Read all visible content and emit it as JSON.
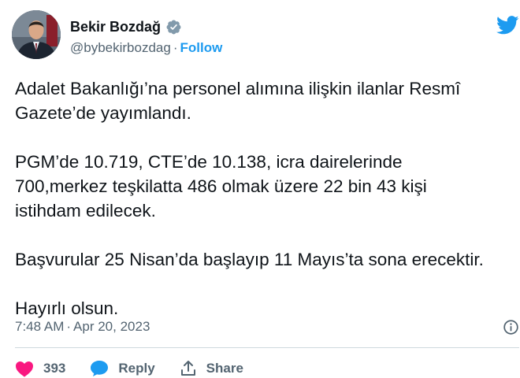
{
  "author": {
    "name": "Bekir Bozdağ",
    "handle": "@bybekirbozdag",
    "separator": "·",
    "follow_label": "Follow"
  },
  "tweet": {
    "paragraphs": [
      [
        "Adalet Bakanlığı’na personel alımına ilişkin ilanlar Resmî",
        "Gazete’de yayımlandı."
      ],
      [
        "PGM’de 10.719, CTE’de 10.138, icra dairelerinde",
        "700,merkez teşkilatta 486 olmak üzere 22 bin 43 kişi",
        "istihdam edilecek."
      ],
      [
        "Başvurular 25 Nisan’da başlayıp 11 Mayıs’ta sona erecektir."
      ],
      [
        "Hayırlı olsun."
      ]
    ]
  },
  "meta": {
    "time": "7:48 AM",
    "separator": "·",
    "date": "Apr 20, 2023"
  },
  "actions": {
    "like_count": "393",
    "reply_label": "Reply",
    "share_label": "Share"
  },
  "colors": {
    "accent": "#1d9bf0",
    "like": "#f91880",
    "muted": "#536471",
    "text": "#0f1419"
  },
  "icons": [
    "verified-badge-icon",
    "twitter-bird-icon",
    "info-icon",
    "heart-icon",
    "reply-bubble-icon",
    "share-icon"
  ]
}
